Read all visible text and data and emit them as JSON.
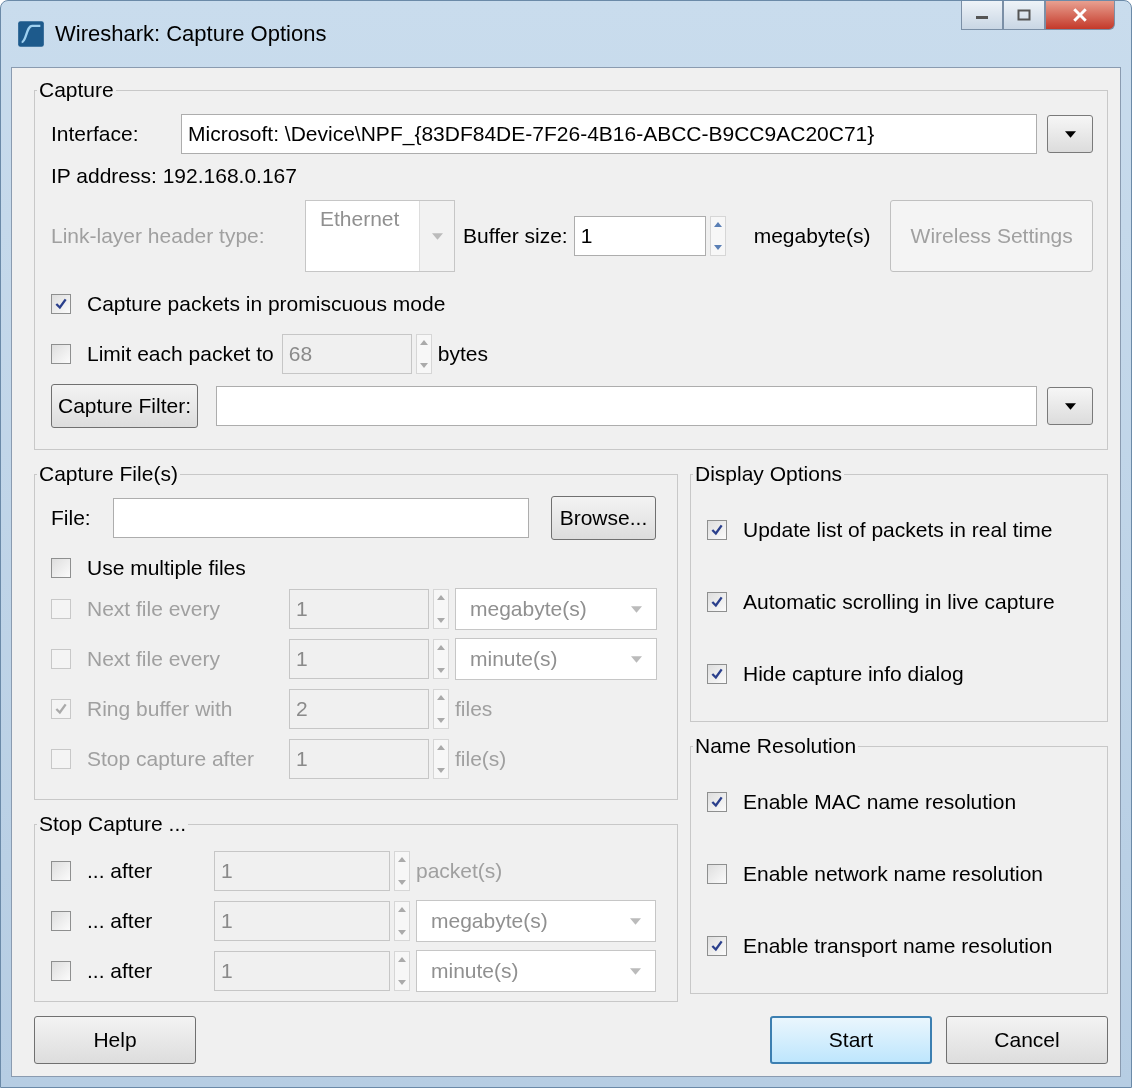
{
  "window": {
    "title": "Wireshark: Capture Options"
  },
  "capture": {
    "title": "Capture",
    "interface": {
      "label": "Interface:",
      "value": "Microsoft: \\Device\\NPF_{83DF84DE-7F26-4B16-ABCC-B9CC9AC20C71}"
    },
    "ip_address": "IP address: 192.168.0.167",
    "link_layer": {
      "label": "Link-layer header type:",
      "value": "Ethernet",
      "disabled": true
    },
    "buffer": {
      "label": "Buffer size:",
      "value": "1",
      "unit": "megabyte(s)"
    },
    "wireless_button": {
      "label": "Wireless Settings",
      "disabled": true
    },
    "promiscuous": {
      "label": "Capture packets in promiscuous mode",
      "checked": true
    },
    "limit": {
      "label": "Limit each packet to",
      "checked": false,
      "value": "68",
      "unit": "bytes",
      "input_disabled": true
    },
    "filter": {
      "button": "Capture Filter:"
    }
  },
  "capture_files": {
    "title": "Capture File(s)",
    "file_label": "File:",
    "browse": "Browse...",
    "multiple": {
      "label": "Use multiple files",
      "checked": false
    },
    "rows": [
      {
        "label": "Next file every",
        "checked": false,
        "disabled": true,
        "value": "1",
        "kind": "dropdown",
        "unit": "megabyte(s)"
      },
      {
        "label": "Next file every",
        "checked": false,
        "disabled": true,
        "value": "1",
        "kind": "dropdown",
        "unit": "minute(s)"
      },
      {
        "label": "Ring buffer with",
        "checked": true,
        "disabled": true,
        "value": "2",
        "kind": "text",
        "unit": "files"
      },
      {
        "label": "Stop capture after",
        "checked": false,
        "disabled": true,
        "value": "1",
        "kind": "text",
        "unit": "file(s)"
      }
    ]
  },
  "stop_capture": {
    "title": "Stop Capture ...",
    "rows": [
      {
        "label": "... after",
        "checked": false,
        "disabled": false,
        "value": "1",
        "kind": "text",
        "unit": "packet(s)"
      },
      {
        "label": "... after",
        "checked": false,
        "disabled": false,
        "value": "1",
        "kind": "dropdown",
        "unit": "megabyte(s)"
      },
      {
        "label": "... after",
        "checked": false,
        "disabled": false,
        "value": "1",
        "kind": "dropdown",
        "unit": "minute(s)"
      }
    ]
  },
  "display_options": {
    "title": "Display Options",
    "items": [
      {
        "label": "Update list of packets in real time",
        "checked": true
      },
      {
        "label": "Automatic scrolling in live capture",
        "checked": true
      },
      {
        "label": "Hide capture info dialog",
        "checked": true
      }
    ]
  },
  "name_resolution": {
    "title": "Name Resolution",
    "items": [
      {
        "label": "Enable MAC name resolution",
        "checked": true
      },
      {
        "label": "Enable network name resolution",
        "checked": false
      },
      {
        "label": "Enable transport name resolution",
        "checked": true
      }
    ]
  },
  "buttons": [
    {
      "label": "Help",
      "default": false
    },
    {
      "label": "Start",
      "default": true
    },
    {
      "label": "Cancel",
      "default": false
    }
  ]
}
